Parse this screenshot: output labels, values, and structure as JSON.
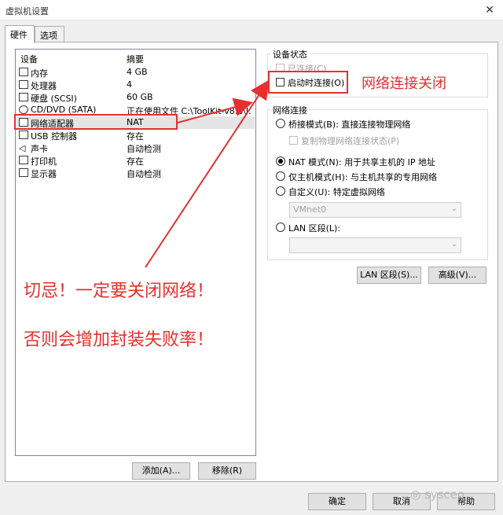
{
  "window": {
    "title": "虚拟机设置",
    "close_glyph": "✕"
  },
  "tabs": [
    {
      "label": "硬件",
      "active": true
    },
    {
      "label": "选项",
      "active": false
    }
  ],
  "device_list": {
    "columns": {
      "device": "设备",
      "summary": "摘要"
    },
    "rows": [
      {
        "name": "内存",
        "summary": "4 GB",
        "icon": "memory-icon",
        "selected": false
      },
      {
        "name": "处理器",
        "summary": "4",
        "icon": "processor-icon",
        "selected": false
      },
      {
        "name": "硬盘 (SCSI)",
        "summary": "60 GB",
        "icon": "hard-disk-icon",
        "selected": false
      },
      {
        "name": "CD/DVD (SATA)",
        "summary": "正在使用文件 C:\\ToolKit-v8.8\\I...",
        "icon": "cd-dvd-icon",
        "selected": false
      },
      {
        "name": "网络适配器",
        "summary": "NAT",
        "icon": "network-adapter-icon",
        "selected": true
      },
      {
        "name": "USB 控制器",
        "summary": "存在",
        "icon": "usb-controller-icon",
        "selected": false
      },
      {
        "name": "声卡",
        "summary": "自动检测",
        "icon": "sound-card-icon",
        "selected": false
      },
      {
        "name": "打印机",
        "summary": "存在",
        "icon": "printer-icon",
        "selected": false
      },
      {
        "name": "显示器",
        "summary": "自动检测",
        "icon": "display-icon",
        "selected": false
      }
    ],
    "add_button": "添加(A)...",
    "remove_button": "移除(R)"
  },
  "device_status": {
    "legend": "设备状态",
    "connected": {
      "label": "已连接(C)",
      "checked": false,
      "enabled": false
    },
    "connect_at_power_on": {
      "label": "启动时连接(O)",
      "checked": false,
      "enabled": true
    }
  },
  "network_connection": {
    "legend": "网络连接",
    "options": [
      {
        "label": "桥接模式(B): 直接连接物理网络",
        "selected": false
      },
      {
        "label": "NAT 模式(N): 用于共享主机的 IP 地址",
        "selected": true
      },
      {
        "label": "仅主机模式(H): 与主机共享的专用网络",
        "selected": false
      },
      {
        "label": "自定义(U): 特定虚拟网络",
        "selected": false
      },
      {
        "label": "LAN 区段(L):",
        "selected": false
      }
    ],
    "replicate_state": {
      "label": "复制物理网络连接状态(P)",
      "checked": false,
      "enabled": false
    },
    "custom_network_value": "VMnet0",
    "lan_segment_value": "",
    "lan_segment_button": "LAN 区段(S)...",
    "advanced_button": "高级(V)..."
  },
  "dialog_buttons": {
    "ok": "确定",
    "cancel": "取消",
    "help": "帮助"
  },
  "annotations": {
    "callout": "网络连接关闭",
    "warning_line1": "切忌！一定要关闭网络！",
    "warning_line2": "否则会增加封装失败率！",
    "highlight_color": "#e53030"
  },
  "watermark": "sysceo"
}
